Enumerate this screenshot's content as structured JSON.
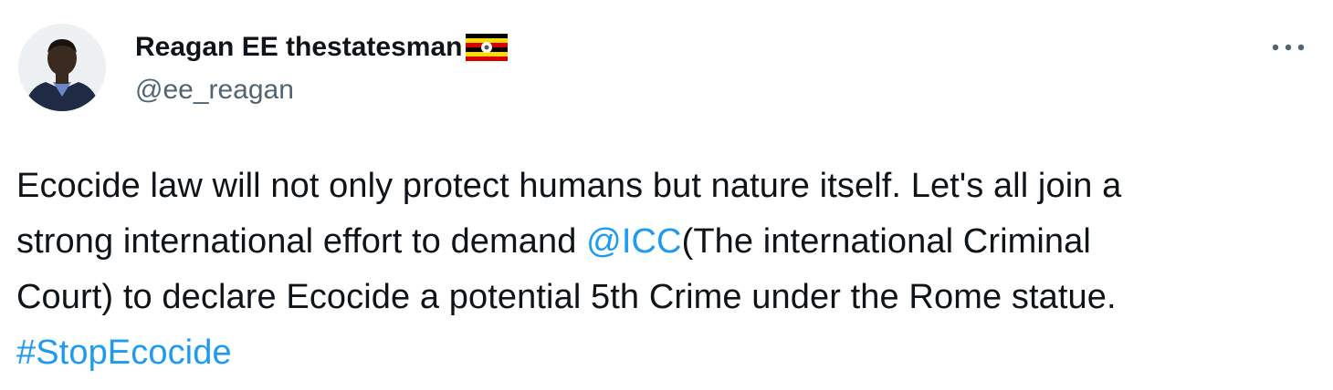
{
  "author": {
    "display_name": "Reagan EE thestatesman",
    "flag_icon": "uganda-flag-icon",
    "handle": "@ee_reagan",
    "avatar_icon": "user-avatar"
  },
  "menu": {
    "more_icon": "more-horizontal-icon"
  },
  "tweet": {
    "line1": "Ecocide law will not only protect humans but nature itself. Let's all join a",
    "line2_before": "strong international effort to demand ",
    "mention": "@ICC",
    "line2_after": "(The international Criminal",
    "line3": "Court) to declare Ecocide a potential 5th Crime under the Rome statue.",
    "hashtag": "#StopEcocide"
  },
  "colors": {
    "link": "#1d9bf0",
    "text": "#0f1419",
    "secondary": "#536471"
  }
}
